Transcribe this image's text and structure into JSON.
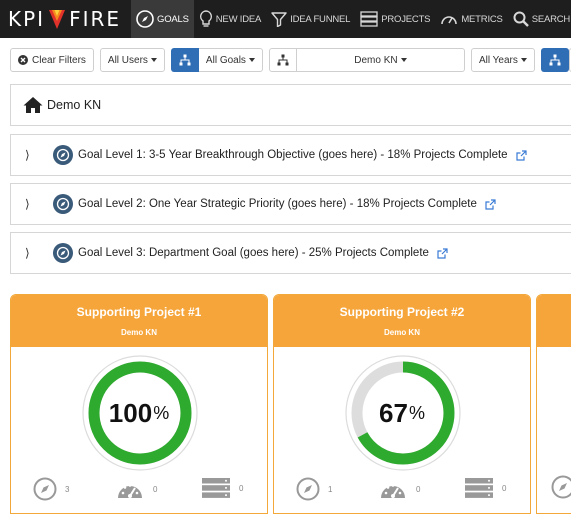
{
  "brand": {
    "left": "KPI",
    "right": "FIRE"
  },
  "nav": {
    "goals": "Goals",
    "new_idea": "New Idea",
    "idea_funnel": "Idea Funnel",
    "projects": "Projects",
    "metrics": "Metrics",
    "search": "Search"
  },
  "filters": {
    "clear": "Clear Filters",
    "users": "All Users",
    "goals": "All Goals",
    "org": "Demo KN",
    "years": "All Years"
  },
  "breadcrumb": {
    "org": "Demo KN"
  },
  "goals": [
    {
      "label": "Goal Level 1: 3-5 Year Breakthrough Objective (goes here) - 18% Projects Complete"
    },
    {
      "label": "Goal Level 2: One Year Strategic Priority (goes here) - 18% Projects Complete"
    },
    {
      "label": "Goal Level 3: Department Goal (goes here) - 25% Projects Complete"
    }
  ],
  "cards": [
    {
      "title": "Supporting Project #1",
      "org": "Demo KN",
      "percent": 100,
      "percent_label": "100",
      "goals_count": "3",
      "metrics_count": "0",
      "projects_count": "0"
    },
    {
      "title": "Supporting Project #2",
      "org": "Demo KN",
      "percent": 67,
      "percent_label": "67",
      "goals_count": "1",
      "metrics_count": "0",
      "projects_count": "0"
    }
  ],
  "percent_symbol": "%",
  "colors": {
    "nav_bg": "#1e1e1e",
    "accent_blue": "#2f6db5",
    "card_orange": "#f6a53a",
    "progress_green": "#2eaa2e",
    "track_gray": "#dddddd"
  }
}
